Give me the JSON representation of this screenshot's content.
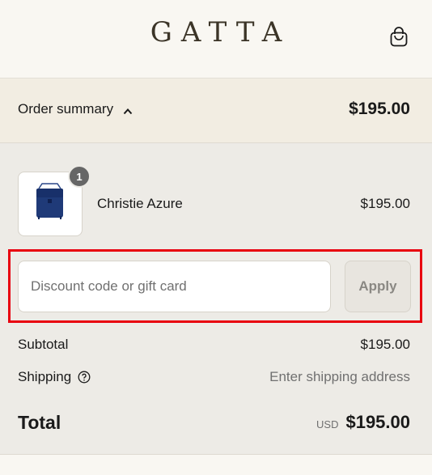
{
  "header": {
    "logo": "GATTA",
    "cart_icon": "shopping-bag-icon"
  },
  "summary_bar": {
    "toggle_label": "Order summary",
    "toggle_icon": "chevron-up-icon",
    "total": "$195.00"
  },
  "line_items": [
    {
      "name": "Christie Azure",
      "price": "$195.00",
      "quantity": "1",
      "image_icon": "navy-handbag-thumbnail"
    }
  ],
  "discount": {
    "placeholder": "Discount code or gift card",
    "value": "",
    "apply_label": "Apply",
    "highlight_color": "#e8000f"
  },
  "totals": {
    "subtotal_label": "Subtotal",
    "subtotal_value": "$195.00",
    "shipping_label": "Shipping",
    "shipping_help_icon": "question-circle-icon",
    "shipping_value": "Enter shipping address",
    "total_label": "Total",
    "currency": "USD",
    "total_value": "$195.00"
  },
  "colors": {
    "page_bg": "#f9f7f2",
    "summary_bg": "#f2ede2",
    "panel_bg": "#edebe6",
    "logo": "#3b3427",
    "product_blue": "#1f3a78"
  }
}
